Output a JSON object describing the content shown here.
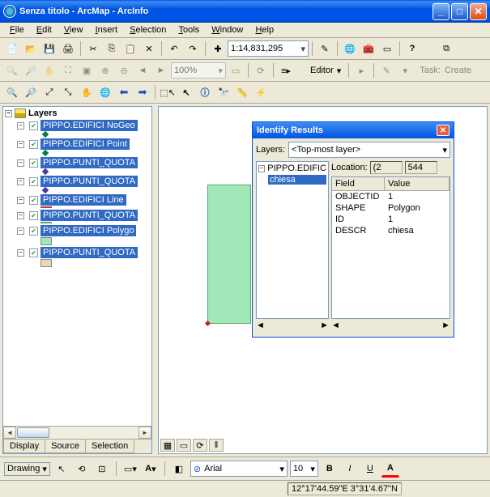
{
  "window": {
    "title": "Senza titolo - ArcMap - ArcInfo"
  },
  "menu": {
    "file": "File",
    "edit": "Edit",
    "view": "View",
    "insert": "Insert",
    "selection": "Selection",
    "tools": "Tools",
    "window": "Window",
    "help": "Help"
  },
  "toolbar": {
    "scale": "1:14,831,295",
    "zoom": "100%",
    "editor": "Editor",
    "task": "Task:",
    "create": "Create"
  },
  "toc": {
    "root": "Layers",
    "items": [
      {
        "label": "PIPPO.EDIFICI NoGeo"
      },
      {
        "label": "PIPPO.EDIFICI Point"
      },
      {
        "label": "PIPPO.PUNTI_QUOTA"
      },
      {
        "label": "PIPPO.PUNTI_QUOTA"
      },
      {
        "label": "PIPPO.EDIFICI Line"
      },
      {
        "label": "PIPPO.PUNTI_QUOTA"
      },
      {
        "label": "PIPPO.EDIFICI Polygo"
      },
      {
        "label": "PIPPO.PUNTI_QUOTA"
      }
    ],
    "tabs": {
      "display": "Display",
      "source": "Source",
      "selection": "Selection"
    }
  },
  "identify": {
    "title": "Identify Results",
    "layers_label": "Layers:",
    "layers_value": "<Top-most layer>",
    "tree_root": "PIPPO.EDIFIC",
    "tree_child": "chiesa",
    "location_label": "Location:",
    "loc_x": "(2",
    "loc_y": "544",
    "grid": {
      "header_field": "Field",
      "header_value": "Value",
      "rows": [
        {
          "field": "OBJECTID",
          "value": "1"
        },
        {
          "field": "SHAPE",
          "value": "Polygon"
        },
        {
          "field": "ID",
          "value": "1"
        },
        {
          "field": "DESCR",
          "value": "chiesa"
        }
      ]
    }
  },
  "drawing": {
    "label": "Drawing",
    "font": "Arial",
    "size": "10",
    "bold": "B",
    "italic": "I",
    "underline": "U",
    "text_tool": "A"
  },
  "status": {
    "coords": "12°17'44.59\"E 3°31'4.67\"N"
  }
}
